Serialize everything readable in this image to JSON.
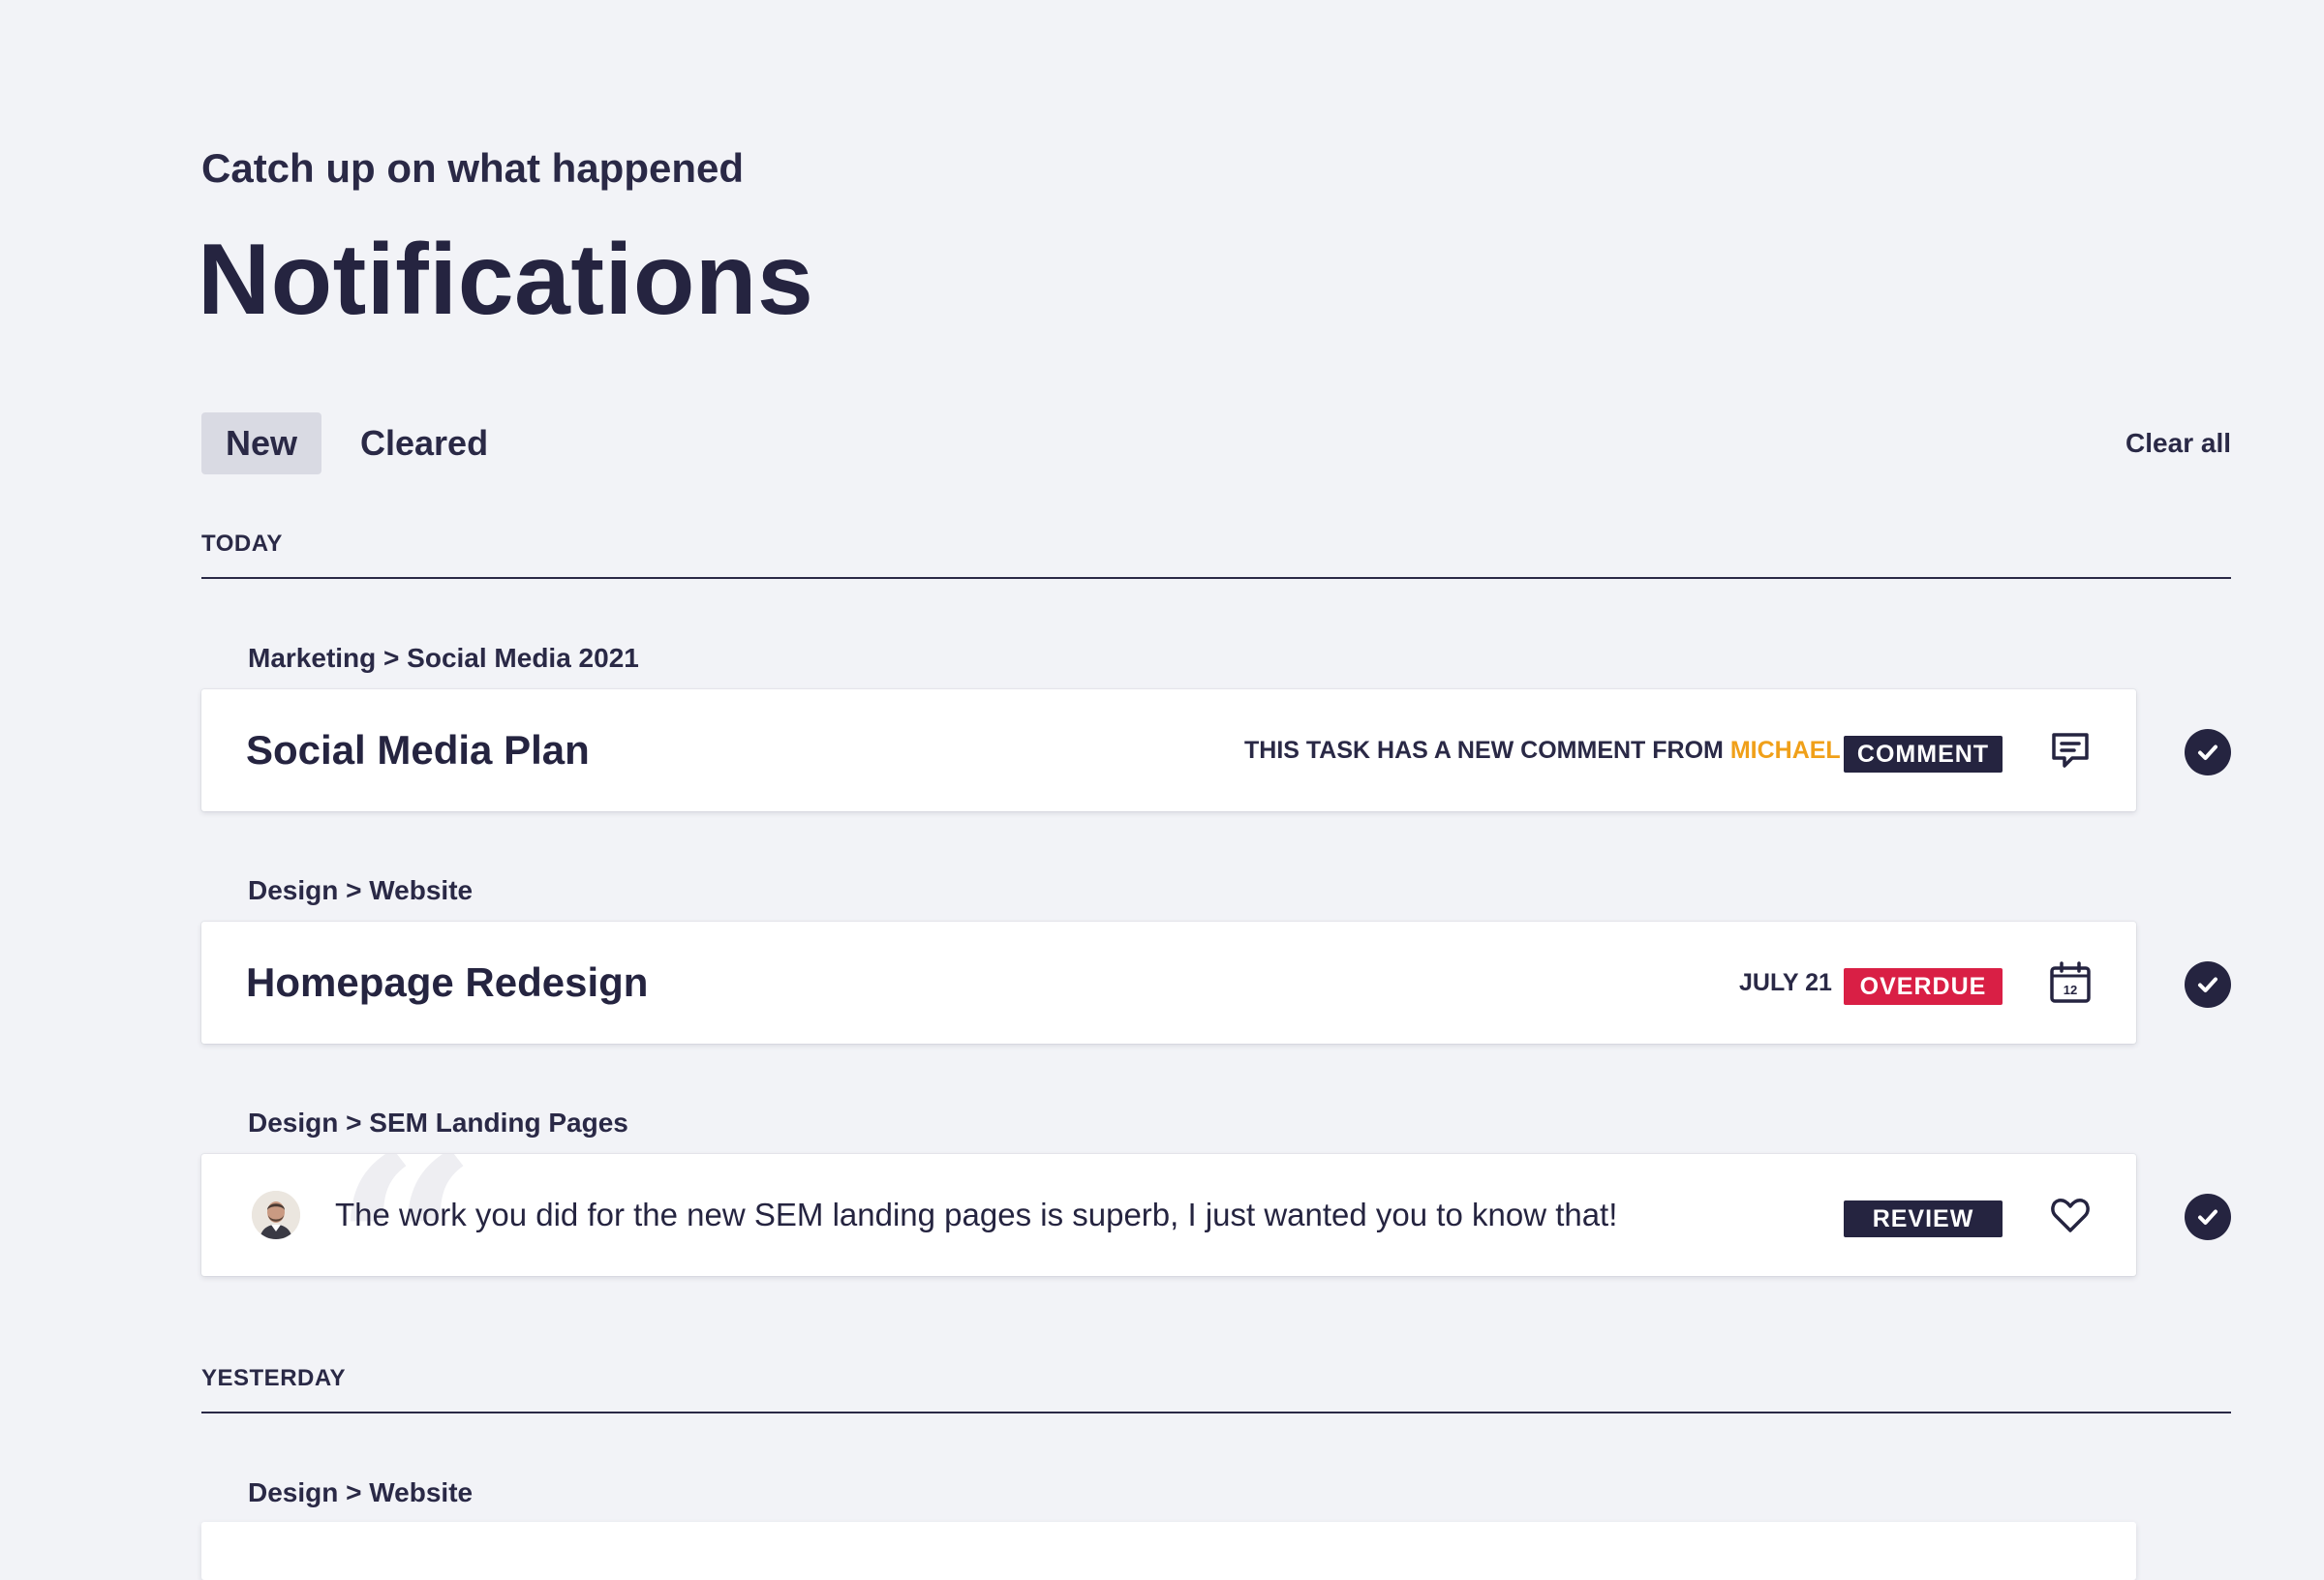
{
  "header": {
    "eyebrow": "Catch up on what happened",
    "title": "Notifications"
  },
  "tabs": [
    {
      "label": "New",
      "active": true
    },
    {
      "label": "Cleared",
      "active": false
    }
  ],
  "actions": {
    "clear_all": "Clear all"
  },
  "sections": [
    {
      "label": "TODAY",
      "items": [
        {
          "breadcrumb": "Marketing > Social Media 2021",
          "title": "Social Media Plan",
          "meta_prefix": "THIS TASK HAS A NEW COMMENT FROM ",
          "meta_highlight": "MICHAEL",
          "badge": "COMMENT",
          "icon": "comment-icon"
        },
        {
          "breadcrumb": "Design > Website",
          "title": "Homepage Redesign",
          "meta": "JULY 21",
          "badge": "OVERDUE",
          "icon": "calendar-icon",
          "calendar_day": "12"
        },
        {
          "breadcrumb": "Design > SEM Landing Pages",
          "quote": "The work you did for the new SEM landing pages is superb, I just wanted you to know that!",
          "badge": "REVIEW",
          "icon": "heart-icon"
        }
      ]
    },
    {
      "label": "YESTERDAY",
      "items": [
        {
          "breadcrumb": "Design > Website"
        }
      ]
    }
  ],
  "colors": {
    "background": "#f2f3f7",
    "text": "#252440",
    "accent": "#f0a019",
    "overdue": "#d91f45",
    "badge": "#252440"
  }
}
